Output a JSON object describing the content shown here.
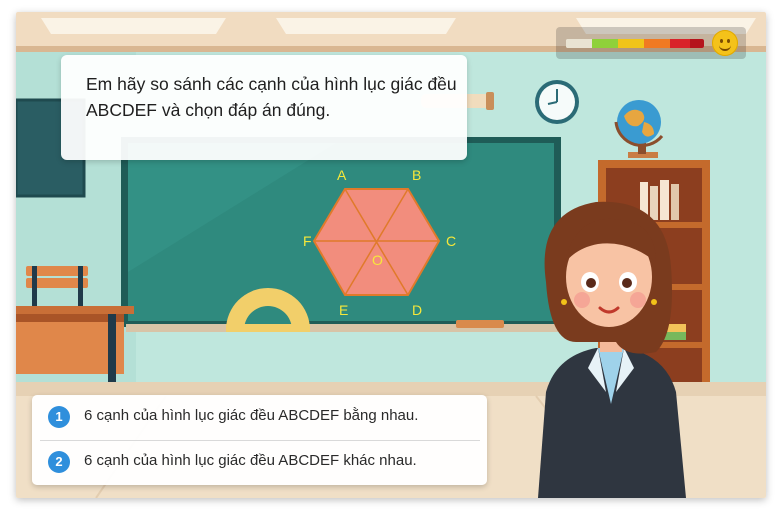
{
  "question": {
    "text": "Em hãy so sánh các cạnh của hình lục giác đều ABCDEF và chọn đáp án đúng."
  },
  "hexagon": {
    "vertices": [
      "A",
      "B",
      "C",
      "D",
      "E",
      "F"
    ],
    "center": "O",
    "fill_color": "#f28d7d",
    "label_color": "#f7e83a"
  },
  "options": [
    {
      "number": "1",
      "text": "6 cạnh của hình lục giác đều ABCDEF bằng nhau."
    },
    {
      "number": "2",
      "text": "6 cạnh của hình lục giác đều ABCDEF khác nhau."
    }
  ],
  "hud": {
    "meter_colors": [
      "#e9e3d2",
      "#8fd13a",
      "#f0c419",
      "#f07a22",
      "#d9232a",
      "#b5141c"
    ],
    "mood_icon": "smiley-face-icon"
  },
  "colors": {
    "accent": "#2f8fdc",
    "board": "#2d7d73",
    "wall": "#bde7dc"
  }
}
